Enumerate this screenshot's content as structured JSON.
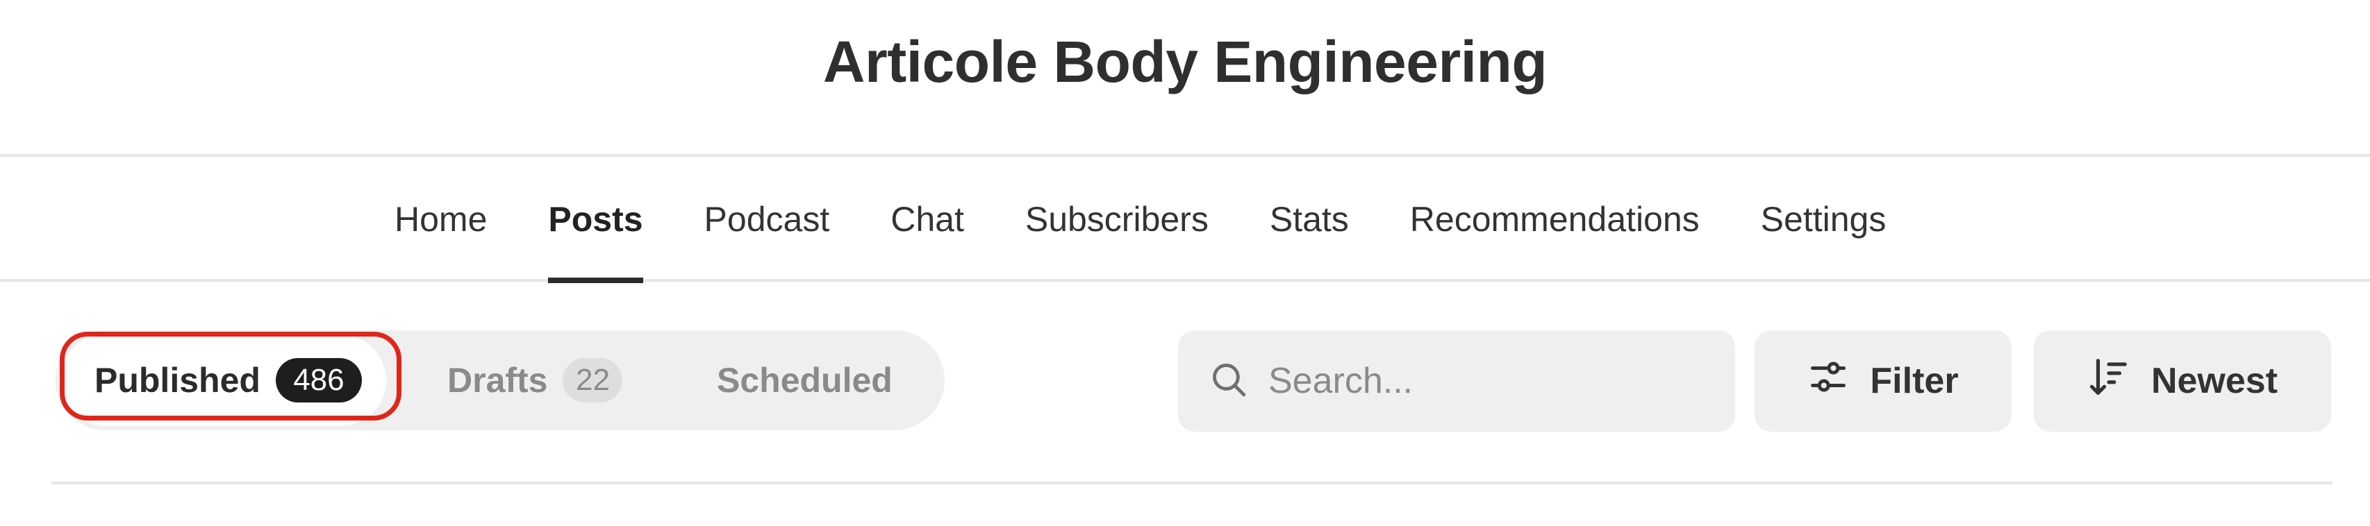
{
  "header": {
    "title": "Articole Body Engineering"
  },
  "nav": {
    "items": [
      {
        "label": "Home",
        "active": false
      },
      {
        "label": "Posts",
        "active": true
      },
      {
        "label": "Podcast",
        "active": false
      },
      {
        "label": "Chat",
        "active": false
      },
      {
        "label": "Subscribers",
        "active": false
      },
      {
        "label": "Stats",
        "active": false
      },
      {
        "label": "Recommendations",
        "active": false
      },
      {
        "label": "Settings",
        "active": false
      }
    ]
  },
  "status_tabs": {
    "published": {
      "label": "Published",
      "count": "486",
      "selected": true
    },
    "drafts": {
      "label": "Drafts",
      "count": "22",
      "selected": false
    },
    "scheduled": {
      "label": "Scheduled",
      "selected": false
    }
  },
  "search": {
    "placeholder": "Search...",
    "value": "",
    "icon": "search-icon"
  },
  "toolbar": {
    "filter_label": "Filter",
    "filter_icon": "sliders-icon",
    "sort_label": "Newest",
    "sort_icon": "sort-descending-icon"
  },
  "colors": {
    "highlight_ring": "#e0261b",
    "control_background": "#efefef",
    "count_pill_dark": "#1e1e1e",
    "text_dark": "#2b2b2b",
    "text_muted": "#8a8a8a"
  }
}
